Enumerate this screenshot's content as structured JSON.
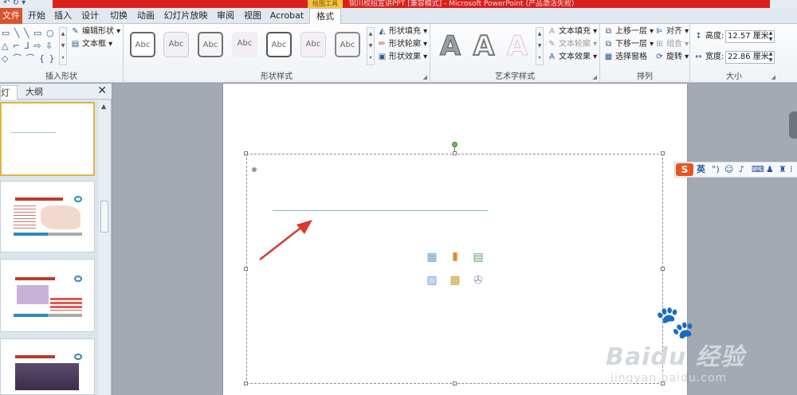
{
  "titlebar": {
    "drawing_tools": "绘图工具",
    "document_title": "铜川校招宣讲PPT [兼容模式] - Microsoft PowerPoint (产品激活失败)"
  },
  "tabs": {
    "file": "文件",
    "items": [
      "开始",
      "插入",
      "设计",
      "切换",
      "动画",
      "幻灯片放映",
      "审阅",
      "视图",
      "Acrobat",
      "格式"
    ],
    "active": "格式"
  },
  "ribbon": {
    "insert_shapes": {
      "label": "插入形状",
      "edit_shape": "编辑形状",
      "text_box": "文本框"
    },
    "shape_styles": {
      "label": "形状样式",
      "swatch_text": "Abc",
      "fill": "形状填充",
      "outline": "形状轮廓",
      "effects": "形状效果"
    },
    "wordart_styles": {
      "label": "艺术字样式",
      "letter": "A",
      "text_fill": "文本填充",
      "text_outline": "文本轮廓",
      "text_effects": "文本效果"
    },
    "arrange": {
      "label": "排列",
      "bring_forward": "上移一层",
      "send_backward": "下移一层",
      "selection_pane": "选择窗格",
      "align": "对齐",
      "group": "组合",
      "rotate": "旋转"
    },
    "size": {
      "label": "大小",
      "height_label": "高度:",
      "height_value": "12.57 厘米",
      "width_label": "宽度:",
      "width_value": "22.86 厘米"
    }
  },
  "panel": {
    "tab_slides": "灯片",
    "tab_outline": "大纲",
    "active": "灯片",
    "thumbnails": [
      {
        "selected": true
      },
      {
        "selected": false
      },
      {
        "selected": false
      },
      {
        "selected": false
      }
    ]
  },
  "ime": {
    "logo": "S",
    "mode": "英"
  },
  "watermark": {
    "brand": "Bai",
    "cn": "经验",
    "url": "jingyan.baidu.com"
  },
  "colors": {
    "file_tab": "#d9532c",
    "titlebar_red": "#d9201c",
    "accent_line": "#7fc3b4",
    "arrow": "#d93a2b",
    "rotate_handle": "#6cbf4a"
  }
}
